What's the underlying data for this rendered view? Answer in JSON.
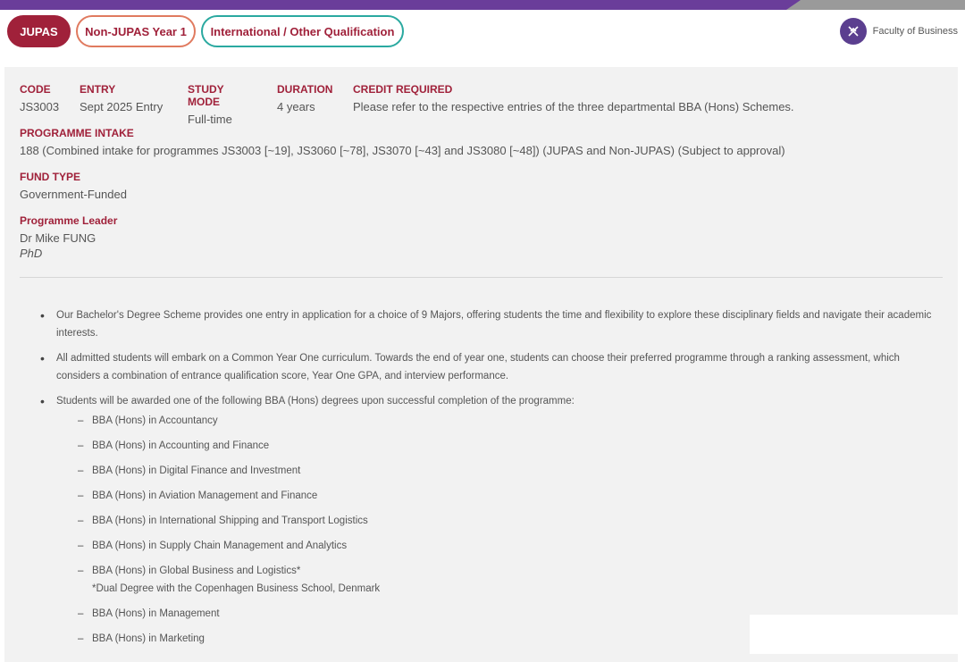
{
  "tabs": {
    "jupas": "JUPAS",
    "non_jupas": "Non-JUPAS Year 1",
    "international": "International / Other Qualification"
  },
  "faculty": {
    "name": "Faculty of Business",
    "icon": "faculty-logo-icon"
  },
  "meta": {
    "code_label": "CODE",
    "code": "JS3003",
    "entry_label": "ENTRY",
    "entry": "Sept 2025 Entry",
    "mode_label": "STUDY MODE",
    "mode": "Full-time",
    "duration_label": "DURATION",
    "duration": "4 years",
    "credit_label": "CREDIT REQUIRED",
    "credit": "Please refer to the respective entries of the three departmental BBA (Hons) Schemes."
  },
  "intake": {
    "label": "PROGRAMME INTAKE",
    "value": "188 (Combined intake for programmes JS3003 [~19], JS3060 [~78], JS3070 [~43] and JS3080 [~48]) (JUPAS and Non-JUPAS) (Subject to approval)"
  },
  "fund": {
    "label": "FUND TYPE",
    "value": "Government-Funded"
  },
  "leader": {
    "label": "Programme Leader",
    "name": "Dr Mike FUNG",
    "title": "PhD"
  },
  "bullets": {
    "b1": "Our Bachelor's Degree Scheme provides one entry in application for a choice of 9 Majors, offering students the time and flexibility to explore these disciplinary fields and navigate their academic interests.",
    "b2": "All admitted students will embark on a Common Year One curriculum. Towards the end of year one, students can choose their preferred programme through a ranking assessment, which considers a combination of entrance qualification score, Year One GPA, and interview performance.",
    "b3": "Students will be awarded one of the following BBA (Hons) degrees upon successful completion of the programme:"
  },
  "degrees": [
    "BBA (Hons) in Accountancy",
    "BBA (Hons) in Accounting and Finance",
    "BBA (Hons) in Digital Finance and Investment",
    "BBA (Hons) in Aviation Management and Finance",
    "BBA (Hons) in International Shipping and Transport Logistics",
    "BBA (Hons) in Supply Chain Management and Analytics",
    "BBA (Hons) in Global Business and Logistics*",
    "BBA (Hons) in Management",
    "BBA (Hons) in Marketing"
  ],
  "degree_note": "*Dual Degree with the Copenhagen Business School, Denmark"
}
